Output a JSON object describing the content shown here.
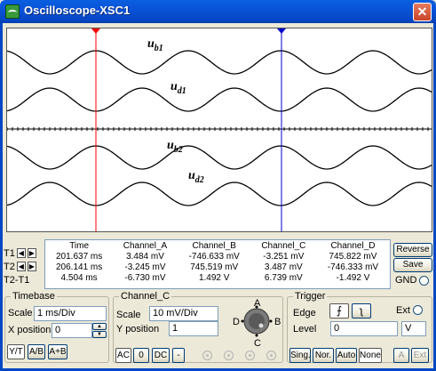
{
  "window": {
    "title": "Oscilloscope-XSC1",
    "close_icon": "✕"
  },
  "screen": {
    "labels": [
      {
        "main": "u",
        "sub": "b1"
      },
      {
        "main": "u",
        "sub": "d1"
      },
      {
        "main": "u",
        "sub": "b2"
      },
      {
        "main": "u",
        "sub": "d2"
      }
    ],
    "cursor_colors": {
      "t1": "#ff0000",
      "t2": "#0000cc"
    }
  },
  "readout": {
    "headers": [
      "Time",
      "Channel_A",
      "Channel_B",
      "Channel_C",
      "Channel_D"
    ],
    "rows": [
      {
        "label": "T1",
        "values": [
          "201.637 ms",
          "3.484 mV",
          "-746.633 mV",
          "-3.251 mV",
          "745.822 mV"
        ]
      },
      {
        "label": "T2",
        "values": [
          "206.141 ms",
          "-3.245 mV",
          "745.519 mV",
          "3.487 mV",
          "-746.333 mV"
        ]
      },
      {
        "label": "T2-T1",
        "values": [
          "4.504 ms",
          "-6.730 mV",
          "1.492 V",
          "6.739 mV",
          "-1.492 V"
        ]
      }
    ]
  },
  "side_buttons": {
    "reverse": "Reverse",
    "save": "Save",
    "gnd": "GND"
  },
  "timebase": {
    "title": "Timebase",
    "scale_label": "Scale",
    "scale_value": "1 ms/Div",
    "xpos_label": "X position",
    "xpos_value": "0",
    "modes": [
      "Y/T",
      "A/B",
      "A+B"
    ]
  },
  "channel": {
    "title": "Channel_C",
    "scale_label": "Scale",
    "scale_value": "10 mV/Div",
    "ypos_label": "Y position",
    "ypos_value": "1",
    "coupling": [
      "AC",
      "0",
      "DC",
      "-"
    ],
    "knob_labels": [
      "A",
      "B",
      "C",
      "D"
    ]
  },
  "trigger": {
    "title": "Trigger",
    "edge_label": "Edge",
    "level_label": "Level",
    "level_value": "0",
    "level_unit": "V",
    "ext_label": "Ext",
    "modes": [
      "Sing.",
      "Nor.",
      "Auto",
      "None"
    ],
    "sources": [
      "A",
      "Ext"
    ]
  }
}
